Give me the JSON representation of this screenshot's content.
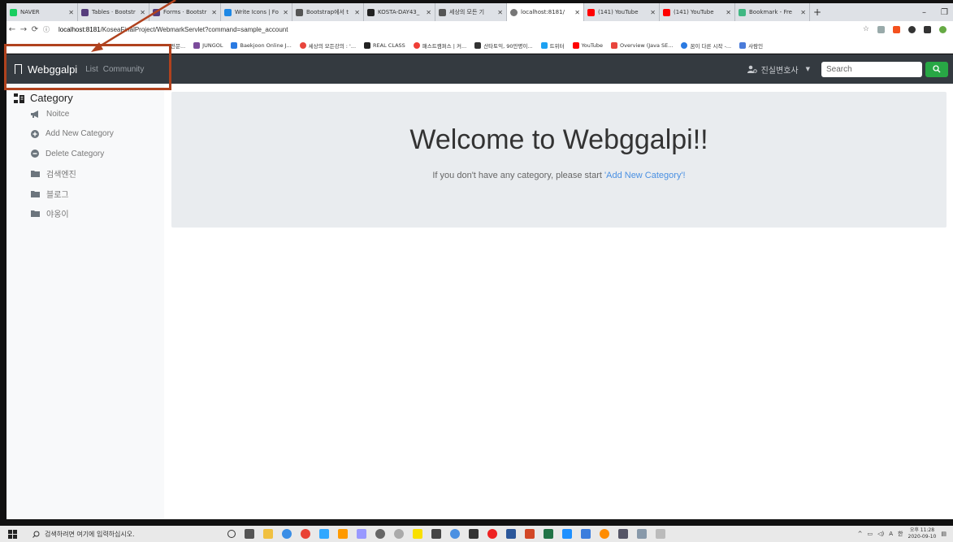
{
  "browser": {
    "tabs": [
      {
        "label": "NAVER",
        "color": "#19ce60",
        "active": false
      },
      {
        "label": "Tables · Bootstr",
        "color": "#563d7c",
        "active": false
      },
      {
        "label": "Forms · Bootstr",
        "color": "#563d7c",
        "active": false
      },
      {
        "label": "Write Icons | Fo",
        "color": "#1e88e5",
        "active": false
      },
      {
        "label": "Bootstrap에서 t",
        "color": "#555555",
        "active": false
      },
      {
        "label": "KOSTA-DAY43_",
        "color": "#222222",
        "active": false
      },
      {
        "label": "세상의 모든 기",
        "color": "#555555",
        "active": false
      },
      {
        "label": "localhost:8181/",
        "color": "#777777",
        "active": true
      },
      {
        "label": "(141) YouTube",
        "color": "#ff0000",
        "active": false
      },
      {
        "label": "(141) YouTube",
        "color": "#ff0000",
        "active": false
      },
      {
        "label": "Bookmark - Fre",
        "color": "#41b883",
        "active": false
      }
    ],
    "new_tab": "+",
    "url_host": "localhost:8181",
    "url_path": "/KoseaFinalProject/WebmarkServlet?command=sample_account",
    "bookmarks": [
      {
        "label": "전문...",
        "color": "#ff8800"
      },
      {
        "label": "JUNGOL",
        "color": "#7b4b9b"
      },
      {
        "label": "Baekjoon Online J...",
        "color": "#2a7ae2"
      },
      {
        "label": "세상의 모든강의 : '...",
        "color": "#e8453c"
      },
      {
        "label": "REAL CLASS",
        "color": "#222222"
      },
      {
        "label": "패스트캠퍼스 | 커...",
        "color": "#ef3e36"
      },
      {
        "label": "산타토익, 90만명이...",
        "color": "#333333"
      },
      {
        "label": "트위터",
        "color": "#1da1f2"
      },
      {
        "label": "YouTube",
        "color": "#ff0000"
      },
      {
        "label": "Overview (Java SE...",
        "color": "#e8453c"
      },
      {
        "label": "꿈이 다른 시작 -...",
        "color": "#2a7ae2"
      },
      {
        "label": "사람인",
        "color": "#4a7bd9"
      }
    ]
  },
  "navbar": {
    "brand": "Webggalpi",
    "links": [
      "List",
      "Community"
    ],
    "user_name": "진실변호사",
    "search_placeholder": "Search"
  },
  "sidebar": {
    "title": "Category",
    "items": [
      {
        "label": "Noitce",
        "icon": "bullhorn-icon"
      },
      {
        "label": "Add New Category",
        "icon": "plus-circle-icon"
      },
      {
        "label": "Delete Category",
        "icon": "minus-circle-icon"
      },
      {
        "label": "검색엔진",
        "icon": "folder-icon"
      },
      {
        "label": "블로그",
        "icon": "folder-icon"
      },
      {
        "label": "야옹이",
        "icon": "folder-icon"
      }
    ]
  },
  "main": {
    "heading": "Welcome to Webggalpi!!",
    "lead_text": "If you don't have any category, please start ",
    "lead_link": "'Add New Category'!"
  },
  "taskbar": {
    "search_placeholder": "검색하려면 여기에 입력하십시오.",
    "time": "오후 11:28",
    "date": "2020-09-10",
    "ime": "A",
    "ime2": "한"
  },
  "colors": {
    "navbar": "#343a40",
    "success": "#28a745",
    "link": "#4a90e2",
    "annotation": "#b0421e"
  }
}
